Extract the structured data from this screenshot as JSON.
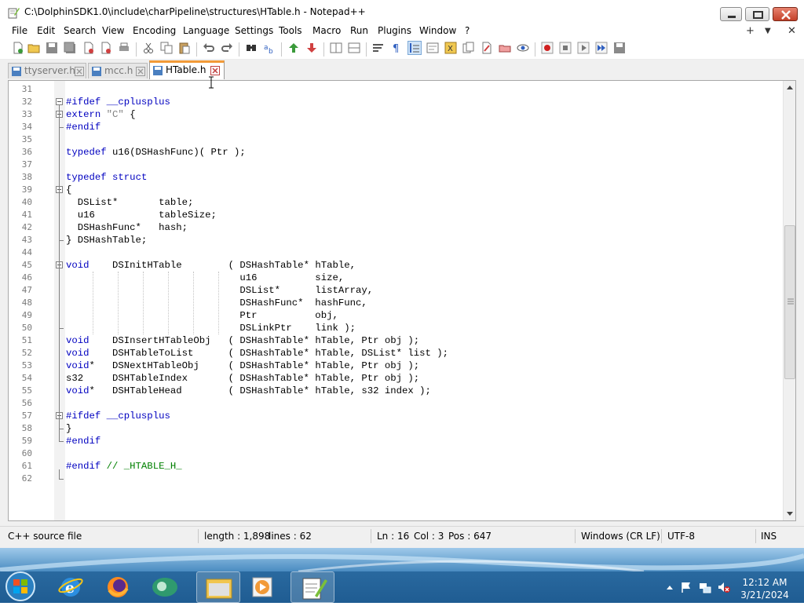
{
  "window": {
    "title": "C:\\DolphinSDK1.0\\include\\charPipeline\\structures\\HTable.h - Notepad++"
  },
  "menu": {
    "items": [
      "File",
      "Edit",
      "Search",
      "View",
      "Encoding",
      "Language",
      "Settings",
      "Tools",
      "Macro",
      "Run",
      "Plugins",
      "Window",
      "?"
    ],
    "right": [
      "+",
      "▼",
      "✕"
    ]
  },
  "tabs": [
    {
      "label": "ttyserver.h",
      "active": false
    },
    {
      "label": "mcc.h",
      "active": false
    },
    {
      "label": "HTable.h",
      "active": true
    }
  ],
  "editor": {
    "lines": [
      {
        "n": "31",
        "code": ""
      },
      {
        "n": "32",
        "code": "#ifdef __cplusplus"
      },
      {
        "n": "33",
        "code": "extern \"C\" {"
      },
      {
        "n": "34",
        "code": "#endif"
      },
      {
        "n": "35",
        "code": ""
      },
      {
        "n": "36",
        "code": "typedef u16(DSHashFunc)( Ptr );"
      },
      {
        "n": "37",
        "code": ""
      },
      {
        "n": "38",
        "code": "typedef struct"
      },
      {
        "n": "39",
        "code": "{"
      },
      {
        "n": "40",
        "code": "  DSList*       table;"
      },
      {
        "n": "41",
        "code": "  u16           tableSize;"
      },
      {
        "n": "42",
        "code": "  DSHashFunc*   hash;"
      },
      {
        "n": "43",
        "code": "} DSHashTable;"
      },
      {
        "n": "44",
        "code": ""
      },
      {
        "n": "45",
        "code": "void    DSInitHTable        ( DSHashTable* hTable,"
      },
      {
        "n": "46",
        "code": "                              u16          size,"
      },
      {
        "n": "47",
        "code": "                              DSList*      listArray,"
      },
      {
        "n": "48",
        "code": "                              DSHashFunc*  hashFunc,"
      },
      {
        "n": "49",
        "code": "                              Ptr          obj,"
      },
      {
        "n": "50",
        "code": "                              DSLinkPtr    link );"
      },
      {
        "n": "51",
        "code": "void    DSInsertHTableObj   ( DSHashTable* hTable, Ptr obj );"
      },
      {
        "n": "52",
        "code": "void    DSHTableToList      ( DSHashTable* hTable, DSList* list );"
      },
      {
        "n": "53",
        "code": "void*   DSNextHTableObj     ( DSHashTable* hTable, Ptr obj );"
      },
      {
        "n": "54",
        "code": "s32     DSHTableIndex       ( DSHashTable* hTable, Ptr obj );"
      },
      {
        "n": "55",
        "code": "void*   DSHTableHead        ( DSHashTable* hTable, s32 index );"
      },
      {
        "n": "56",
        "code": ""
      },
      {
        "n": "57",
        "code": "#ifdef __cplusplus"
      },
      {
        "n": "58",
        "code": "}"
      },
      {
        "n": "59",
        "code": "#endif"
      },
      {
        "n": "60",
        "code": ""
      },
      {
        "n": "61",
        "code": "#endif // _HTABLE_H_"
      },
      {
        "n": "62",
        "code": ""
      }
    ]
  },
  "status": {
    "filetype": "C++ source file",
    "length": "length : 1,898",
    "lines": "lines : 62",
    "ln": "Ln : 16",
    "col": "Col : 3",
    "pos": "Pos : 647",
    "eol": "Windows (CR LF)",
    "encoding": "UTF-8",
    "mode": "INS"
  },
  "taskbar": {
    "time": "12:12 AM",
    "date": "3/21/2024"
  },
  "colors": {
    "keyword": "#0000c0",
    "string": "#808080",
    "comment": "#008000",
    "active_tab_accent": "#f29a38"
  },
  "icons": [
    "notepadpp-icon",
    "new-file-icon",
    "open-file-icon",
    "save-icon",
    "save-all-icon",
    "close-icon",
    "close-all-icon",
    "print-icon",
    "cut-icon",
    "copy-icon",
    "paste-icon",
    "undo-icon",
    "redo-icon",
    "find-icon",
    "replace-icon",
    "zoom-in-icon",
    "zoom-out-icon",
    "sync-vertical-icon",
    "sync-horizontal-icon",
    "word-wrap-icon",
    "show-all-characters-icon",
    "indent-guide-icon",
    "macro-record-icon",
    "macro-stop-icon",
    "macro-play-icon",
    "macro-run-multiple-icon",
    "macro-save-icon",
    "windows-start-icon",
    "internet-explorer-icon",
    "firefox-icon",
    "vlc-icon",
    "file-explorer-icon",
    "media-player-icon",
    "notepadpp-taskbar-icon",
    "flag-icon",
    "network-icon",
    "volume-muted-icon",
    "show-hidden-icons-icon"
  ]
}
